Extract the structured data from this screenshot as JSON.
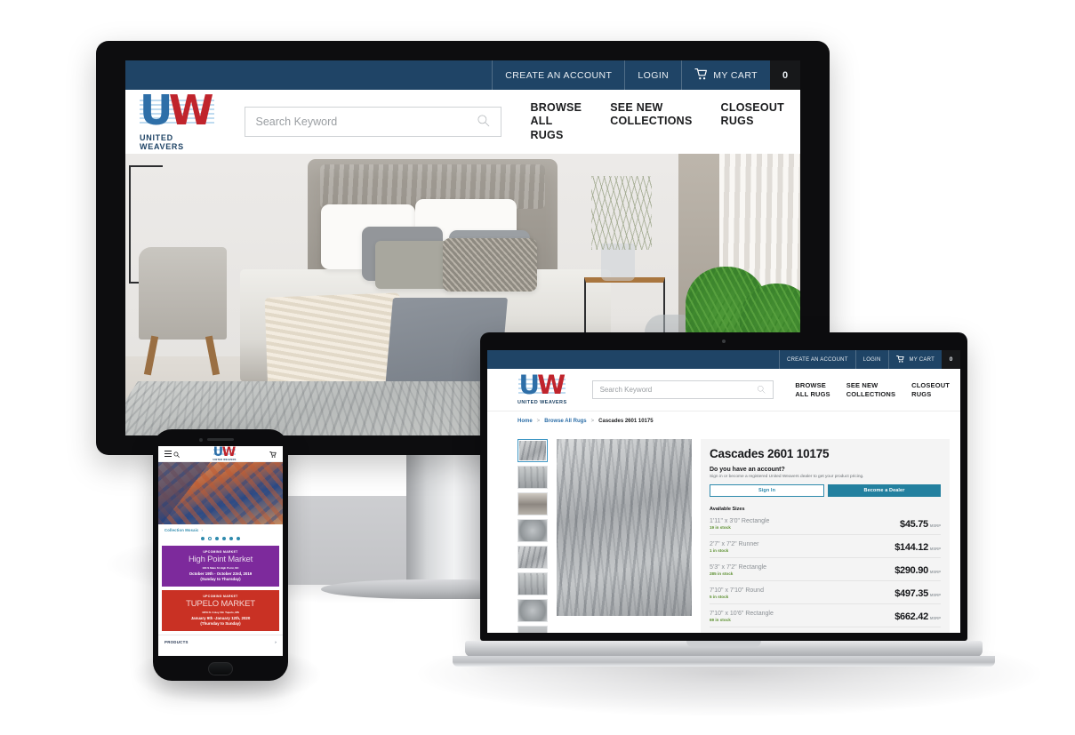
{
  "site": {
    "brand": {
      "logo_u": "U",
      "logo_w": "W",
      "logo_text": "UNITED WEAVERS"
    },
    "topbar": {
      "create_account": "CREATE AN ACCOUNT",
      "login": "LOGIN",
      "my_cart": "MY CART",
      "cart_count": "0"
    },
    "search_placeholder": "Search Keyword",
    "nav": [
      {
        "line1": "BROWSE",
        "line2": "ALL RUGS"
      },
      {
        "line1": "SEE NEW",
        "line2": "COLLECTIONS"
      },
      {
        "line1": "CLOSEOUT",
        "line2": "RUGS"
      }
    ]
  },
  "laptop": {
    "breadcrumb": {
      "home": "Home",
      "browse": "Browse All Rugs",
      "current": "Cascades 2601 10175",
      "separator": ">"
    },
    "product": {
      "title": "Cascades 2601 10175",
      "account_question": "Do you have an account?",
      "account_sub": "Sign in or become a registered United Weavers dealer to get your product pricing.",
      "sign_in": "Sign In",
      "become_dealer": "Become a Dealer",
      "available_sizes_label": "Available Sizes",
      "msrp_label": "MSRP",
      "sizes": [
        {
          "name": "1'11\" x 3'0\" Rectangle",
          "stock": "19 in stock",
          "price": "$45.75"
        },
        {
          "name": "2'7\" x 7'2\" Runner",
          "stock": "1 in stock",
          "price": "$144.12"
        },
        {
          "name": "5'3\" x 7'2\" Rectangle",
          "stock": "285 in stock",
          "price": "$290.90"
        },
        {
          "name": "7'10\" x 7'10\" Round",
          "stock": "5 in stock",
          "price": "$497.35"
        },
        {
          "name": "7'10\" x 10'6\" Rectangle",
          "stock": "69 in stock",
          "price": "$662.42"
        }
      ],
      "thumbnail_count": 8,
      "selected_thumbnail": 1
    }
  },
  "phone": {
    "carousel_caption": "Collection Mosaic",
    "carousel_arrow": "›",
    "dots_total": 6,
    "dots_active_index": 1,
    "cards": [
      {
        "kicker": "UPCOMING MARKET",
        "title": "High Point Market",
        "address": "184 S Main St High Point, NC",
        "dates": "October 19th - October 23rd, 2019",
        "days": "(Sunday to Thursday)",
        "color": "#7d2a9c"
      },
      {
        "kicker": "UPCOMING MARKET",
        "title": "TUPELO MARKET",
        "address": "1879 N. Coley Rd. Tupelo, MS",
        "dates": "January 9th -January 12th, 2020",
        "days": "(Thursday to Sunday)",
        "color": "#c93124"
      }
    ],
    "products_label": "PRODUCTS",
    "products_arrow": "›"
  },
  "colors": {
    "header_blue": "#1f4466",
    "logo_blue": "#2e6fa8",
    "logo_red": "#c0242c",
    "teal": "#23809f",
    "stock_green": "#5b8f2e"
  }
}
